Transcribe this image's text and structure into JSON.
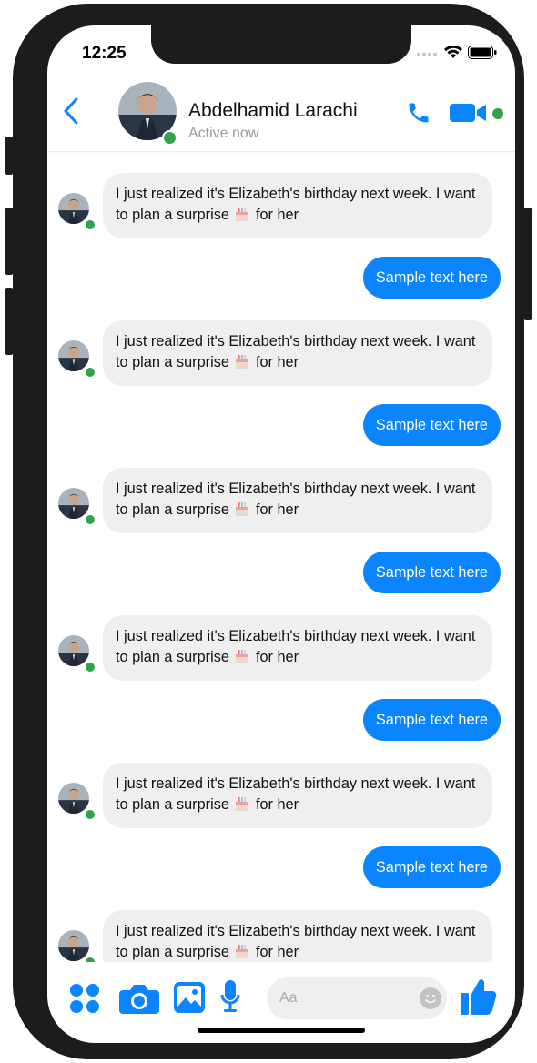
{
  "status": {
    "time": "12:25"
  },
  "header": {
    "name": "Abdelhamid Larachi",
    "subtitle": "Active now"
  },
  "messages": [
    {
      "dir": "in",
      "text_before": "I just realized it's Elizabeth's birthday next week. I want to plan a surprise",
      "text_after": "for her"
    },
    {
      "dir": "out",
      "text": "Sample text here"
    },
    {
      "dir": "in",
      "text_before": "I just realized it's Elizabeth's birthday next week. I want to plan a surprise",
      "text_after": "for her"
    },
    {
      "dir": "out",
      "text": "Sample text here"
    },
    {
      "dir": "in",
      "text_before": "I just realized it's Elizabeth's birthday next week. I want to plan a surprise",
      "text_after": "for her"
    },
    {
      "dir": "out",
      "text": "Sample text here"
    },
    {
      "dir": "in",
      "text_before": "I just realized it's Elizabeth's birthday next week. I want to plan a surprise",
      "text_after": "for her"
    },
    {
      "dir": "out",
      "text": "Sample text here"
    },
    {
      "dir": "in",
      "text_before": "I just realized it's Elizabeth's birthday next week. I want to plan a surprise",
      "text_after": "for her"
    },
    {
      "dir": "out",
      "text": "Sample text here"
    },
    {
      "dir": "in",
      "text_before": "I just realized it's Elizabeth's birthday next week. I want to plan a surprise",
      "text_after": "for her"
    }
  ],
  "composer": {
    "placeholder": "Aa"
  },
  "icons": {
    "back": "chevron-left-icon",
    "call": "phone-icon",
    "video": "video-camera-icon",
    "apps": "grid-dots-icon",
    "camera": "camera-icon",
    "gallery": "image-icon",
    "mic": "microphone-icon",
    "emoji": "smiley-icon",
    "like": "thumbs-up-icon",
    "cake": "birthday-cake-emoji"
  },
  "colors": {
    "accent": "#0a84ff",
    "online": "#31a24c",
    "incoming_bubble": "#efefef"
  }
}
